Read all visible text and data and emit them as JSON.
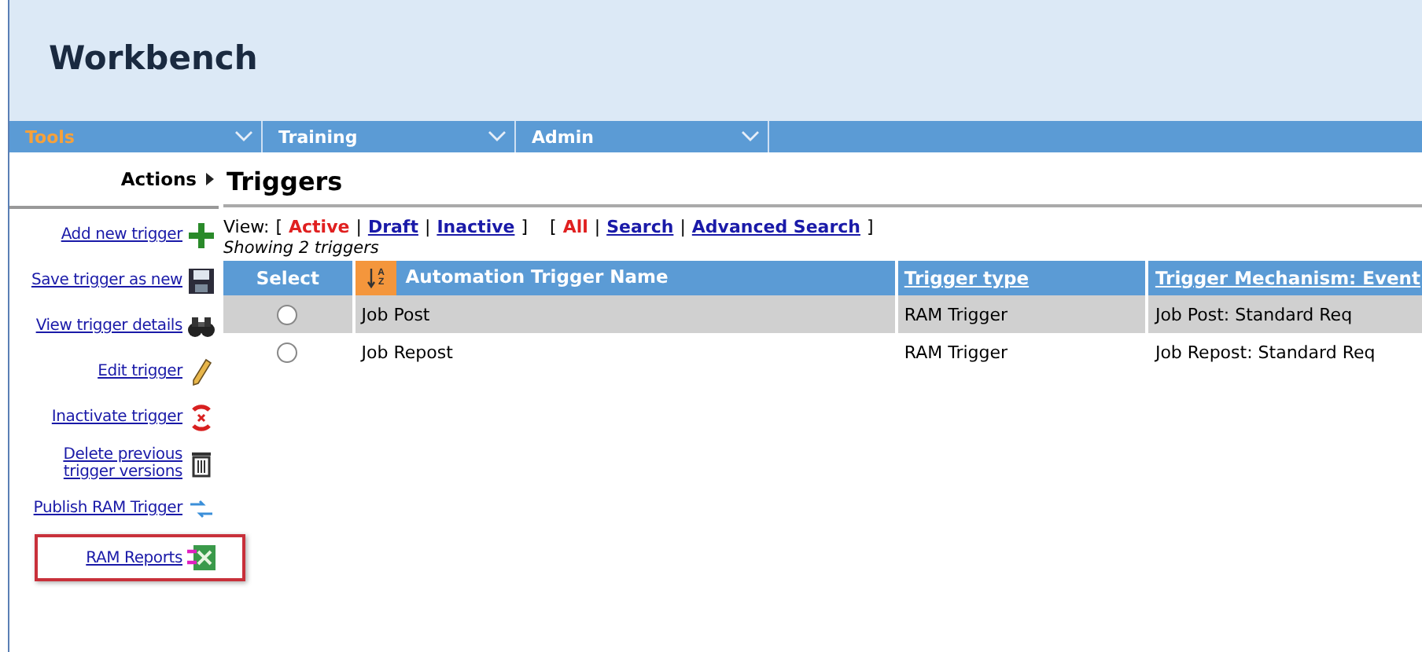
{
  "app": {
    "title": "Workbench"
  },
  "nav": [
    {
      "label": "Tools",
      "selected": true
    },
    {
      "label": "Training",
      "selected": false
    },
    {
      "label": "Admin",
      "selected": false
    }
  ],
  "sidebar": {
    "title": "Actions",
    "items": [
      {
        "label": "Add new trigger",
        "kind": "add",
        "highlighted": false
      },
      {
        "label": "Save trigger as new",
        "kind": "save",
        "highlighted": false
      },
      {
        "label": "View trigger details",
        "kind": "view",
        "highlighted": false
      },
      {
        "label": "Edit trigger",
        "kind": "edit",
        "highlighted": false
      },
      {
        "label": "Inactivate trigger",
        "kind": "inactivate",
        "highlighted": false
      },
      {
        "label": "Delete previous trigger versions",
        "kind": "delete",
        "highlighted": false
      },
      {
        "label": "Publish RAM Trigger",
        "kind": "publish",
        "highlighted": false
      },
      {
        "label": "RAM Reports",
        "kind": "reports",
        "highlighted": true
      }
    ]
  },
  "page": {
    "title": "Triggers",
    "view_label": "View:",
    "filter_groups": [
      {
        "open": "[",
        "close": "]",
        "separator": "|",
        "items": [
          {
            "label": "Active",
            "selected": true
          },
          {
            "label": "Draft",
            "selected": false
          },
          {
            "label": "Inactive",
            "selected": false
          }
        ]
      },
      {
        "open": "[",
        "close": "]",
        "separator": "|",
        "items": [
          {
            "label": "All",
            "selected": true
          },
          {
            "label": "Search",
            "selected": false
          },
          {
            "label": "Advanced Search",
            "selected": false
          }
        ]
      }
    ],
    "count": "Showing 2  triggers"
  },
  "table": {
    "columns": [
      {
        "label": "Select",
        "kind": "plain"
      },
      {
        "label": "Automation Trigger Name",
        "kind": "sorted",
        "sort_letters": [
          "A",
          "Z"
        ]
      },
      {
        "label": "Trigger type",
        "kind": "link"
      },
      {
        "label": "Trigger Mechanism: Event",
        "kind": "link"
      }
    ],
    "rows": [
      {
        "selected": true,
        "checked": false,
        "cells": [
          "",
          "Job Post",
          "RAM Trigger",
          "Job Post: Standard Req"
        ]
      },
      {
        "selected": false,
        "checked": false,
        "cells": [
          "",
          "Job Repost",
          "RAM Trigger",
          "Job Repost: Standard Req"
        ]
      }
    ]
  }
}
